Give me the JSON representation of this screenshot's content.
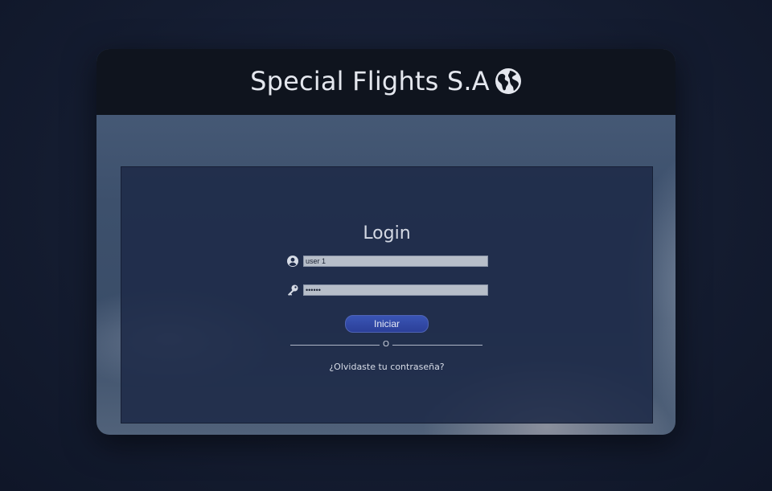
{
  "header": {
    "title": "Special Flights S.A",
    "logo_icon": "globe-americas-icon"
  },
  "login": {
    "title": "Login",
    "username": {
      "icon": "user-circle-icon",
      "value": "user 1"
    },
    "password": {
      "icon": "key-icon",
      "value": "••••••"
    },
    "submit_label": "Iniciar",
    "divider_text": "O",
    "forgot_label": "¿Olvidaste tu contraseña?"
  },
  "colors": {
    "header_bg": "#0f141e",
    "panel_bg": "#1e2a48",
    "button_bg": "#2f47a6",
    "input_bg": "#b7bec9"
  }
}
